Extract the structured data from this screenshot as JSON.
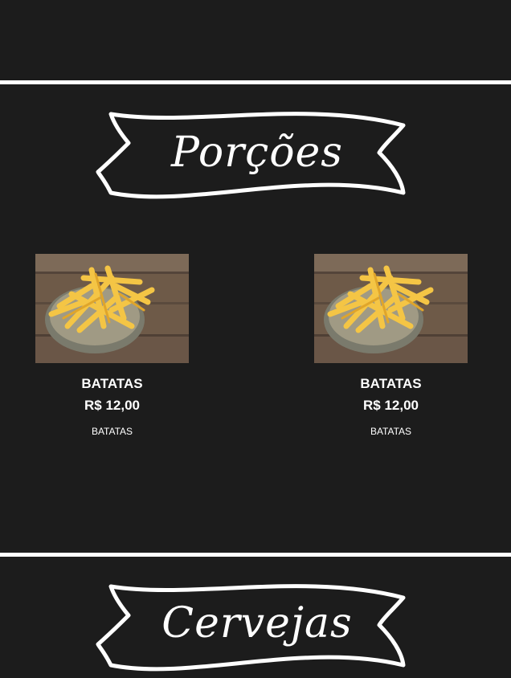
{
  "sections": [
    {
      "title": "Porções",
      "items": [
        {
          "name": "BATATAS",
          "price": "R$ 12,00",
          "description": "BATATAS",
          "image_icon": "french-fries-photo"
        },
        {
          "name": "BATATAS",
          "price": "R$ 12,00",
          "description": "BATATAS",
          "image_icon": "french-fries-photo"
        }
      ]
    },
    {
      "title": "Cervejas",
      "items": []
    }
  ],
  "colors": {
    "background": "#1c1c1c",
    "accent": "#ffffff"
  }
}
